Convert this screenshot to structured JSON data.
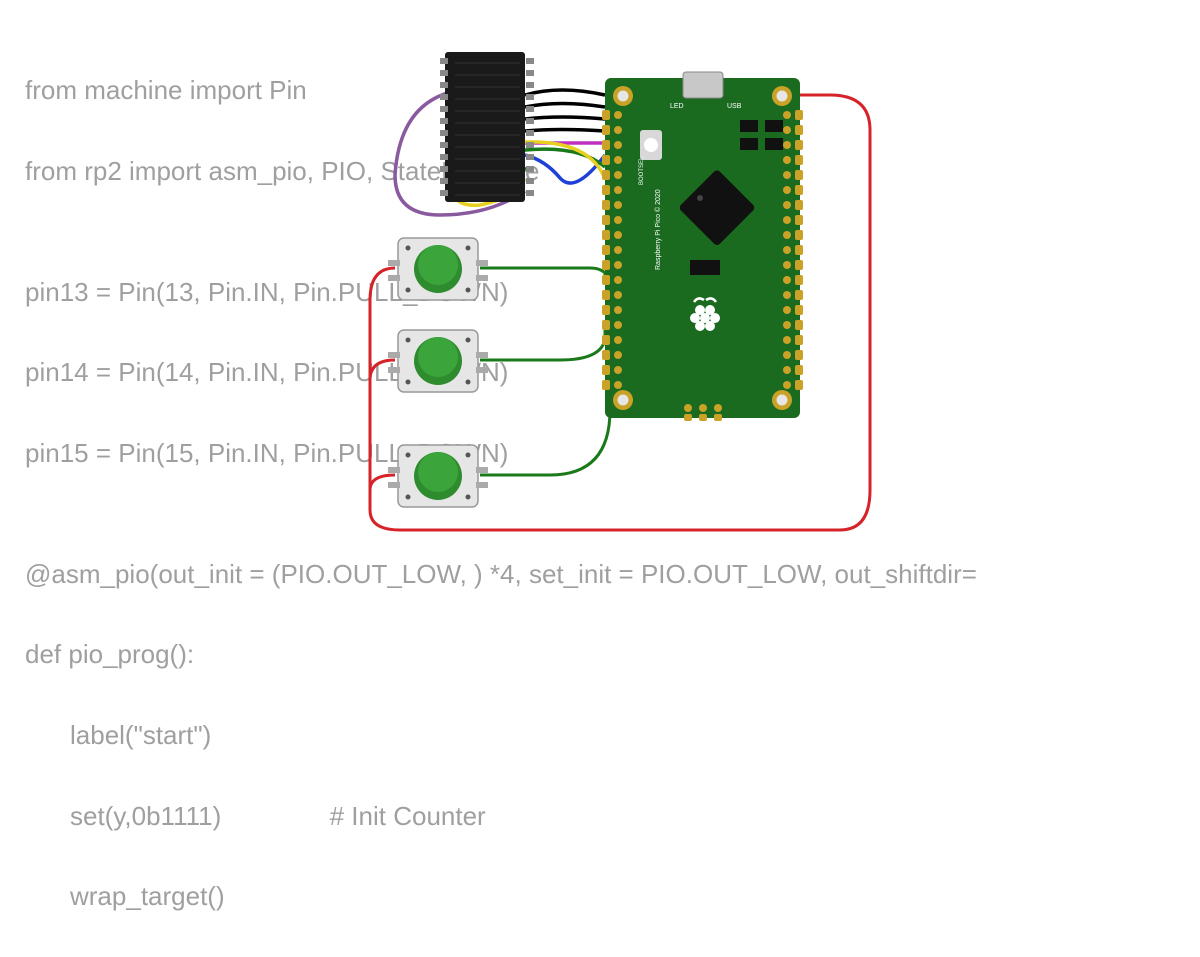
{
  "code": {
    "line1": "from machine import Pin",
    "line2": "from rp2 import asm_pio, PIO, StateMachine",
    "line3": "",
    "line4": "pin13 = Pin(13, Pin.IN, Pin.PULL_DOWN)",
    "line5": "pin14 = Pin(14, Pin.IN, Pin.PULL_DOWN)",
    "line6": "pin15 = Pin(15, Pin.IN, Pin.PULL_DOWN)",
    "line7": "",
    "line8": "@asm_pio(out_init = (PIO.OUT_LOW, ) *4, set_init = PIO.OUT_LOW, out_shiftdir=",
    "line9": "def pio_prog():",
    "line10": "label(\"start\")",
    "line11": "set(y,0b1111)               # Init Counter",
    "line12": "wrap_target()"
  },
  "board": {
    "name": "Raspberry Pi Pico",
    "labels": {
      "led": "LED",
      "usb": "USB",
      "bootsel": "BOOTSEL",
      "copyright": "Raspberry Pi Pico © 2020"
    }
  },
  "components": {
    "header_pins": 12,
    "buttons": 3,
    "button_color": "#2e8b2e"
  },
  "wires": [
    {
      "color": "#000000",
      "from": "header",
      "to": "pico-top-1"
    },
    {
      "color": "#000000",
      "from": "header",
      "to": "pico-top-2"
    },
    {
      "color": "#000000",
      "from": "header",
      "to": "pico-top-3"
    },
    {
      "color": "#000000",
      "from": "header",
      "to": "pico-top-4"
    },
    {
      "color": "#c030c0",
      "from": "header",
      "to": "pico-5"
    },
    {
      "color": "#1e3fd8",
      "from": "header",
      "to": "pico-6"
    },
    {
      "color": "#1a7a1a",
      "from": "header",
      "to": "pico-7"
    },
    {
      "color": "#e8d020",
      "from": "header",
      "to": "pico-8"
    },
    {
      "color": "#8a5a9e",
      "from": "header",
      "to": "wrap-left"
    },
    {
      "color": "#1a7a1a",
      "from": "button1",
      "to": "pico-right"
    },
    {
      "color": "#1a7a1a",
      "from": "button2",
      "to": "pico-right"
    },
    {
      "color": "#1a7a1a",
      "from": "button3",
      "to": "pico-right"
    },
    {
      "color": "#d6232a",
      "from": "buttons",
      "to": "pico-power"
    }
  ]
}
